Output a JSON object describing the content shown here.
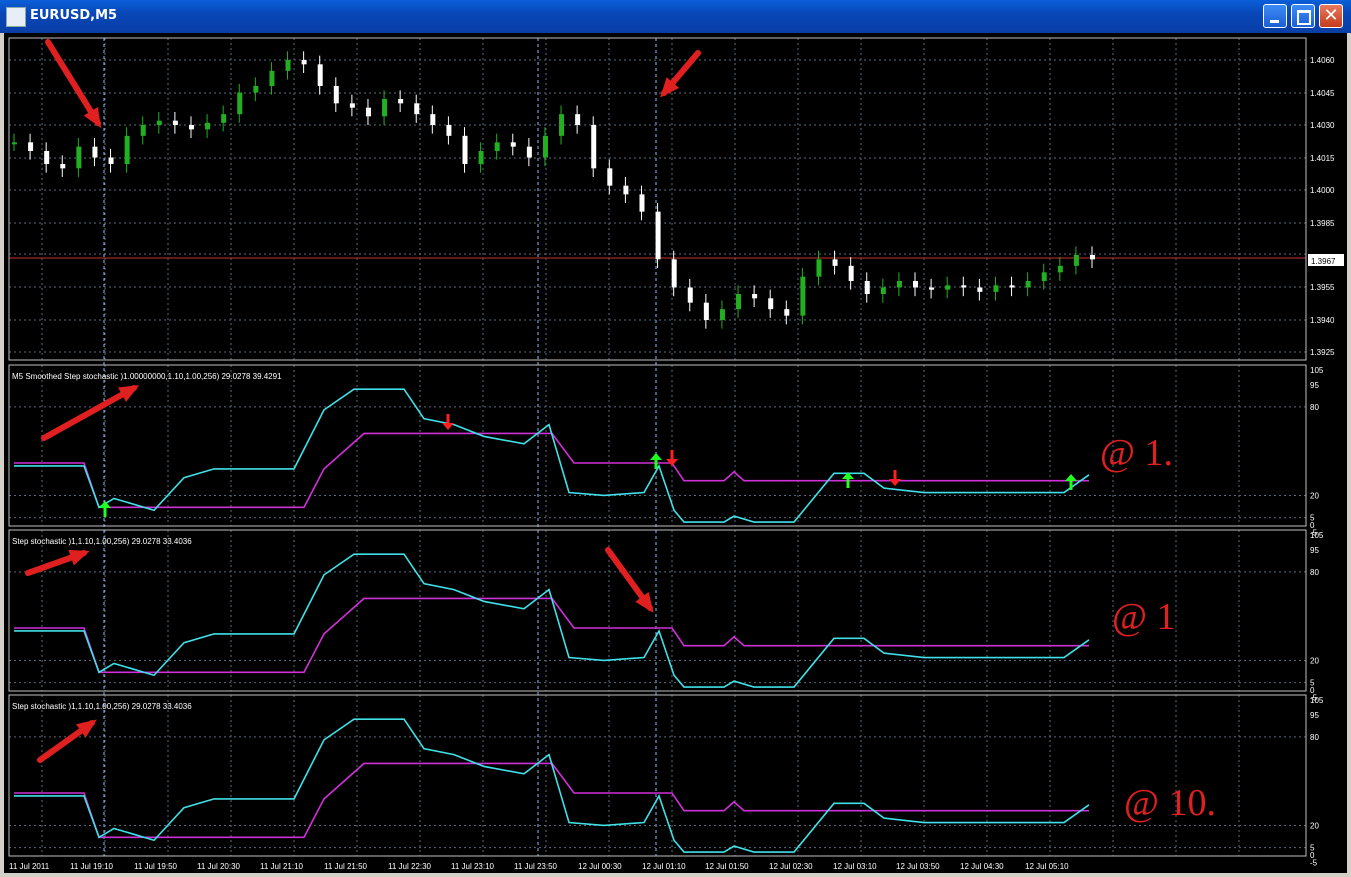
{
  "window": {
    "title": "EURUSD,M5"
  },
  "main_chart": {
    "price_labels": [
      "1.4060",
      "1.4045",
      "1.4030",
      "1.4015",
      "1.4000",
      "1.3985",
      "1.3955",
      "1.3940",
      "1.3925"
    ],
    "current_price": "1.3967"
  },
  "panels": [
    {
      "label": "M5  Smoothed Step stochastic )1.00000000,1.10,1.00,256) 29.0278 39.4291",
      "annotation": "@ 1.",
      "levels": [
        "105",
        "95",
        "80",
        "20",
        "5",
        "0",
        "-5"
      ]
    },
    {
      "label": "Step stochastic )1,1.10,1.00,256) 29.0278 33.4036",
      "annotation": "@ 1",
      "levels": [
        "105",
        "95",
        "80",
        "20",
        "5",
        "0",
        "-5"
      ]
    },
    {
      "label": "Step stochastic )1,1.10,1.00,256) 29.0278 33.4036",
      "annotation": "@ 10.",
      "levels": [
        "105",
        "95",
        "80",
        "20",
        "5",
        "0",
        "-5"
      ]
    }
  ],
  "time_axis": [
    "11 Jul 2011",
    "11 Jul 19:10",
    "11 Jul 19:50",
    "11 Jul 20:30",
    "11 Jul 21:10",
    "11 Jul 21:50",
    "11 Jul 22:30",
    "11 Jul 23:10",
    "11 Jul 23:50",
    "12 Jul 00:30",
    "12 Jul 01:10",
    "12 Jul 01:50",
    "12 Jul 02:30",
    "12 Jul 03:10",
    "12 Jul 03:50",
    "12 Jul 04:30",
    "12 Jul 05:10"
  ],
  "colors": {
    "bull_candle": "#22b022",
    "bear_candle": "#ffffff",
    "fast_line": "#40e0e8",
    "slow_line": "#d030d8",
    "annotation": "#e02020",
    "up_arrow": "#20ff20",
    "down_arrow": "#ff2020",
    "grid": "#5a6a7a",
    "price_line": "#c83030"
  },
  "icons": [
    "app-icon",
    "minimize-icon",
    "maximize-icon",
    "close-icon"
  ]
}
